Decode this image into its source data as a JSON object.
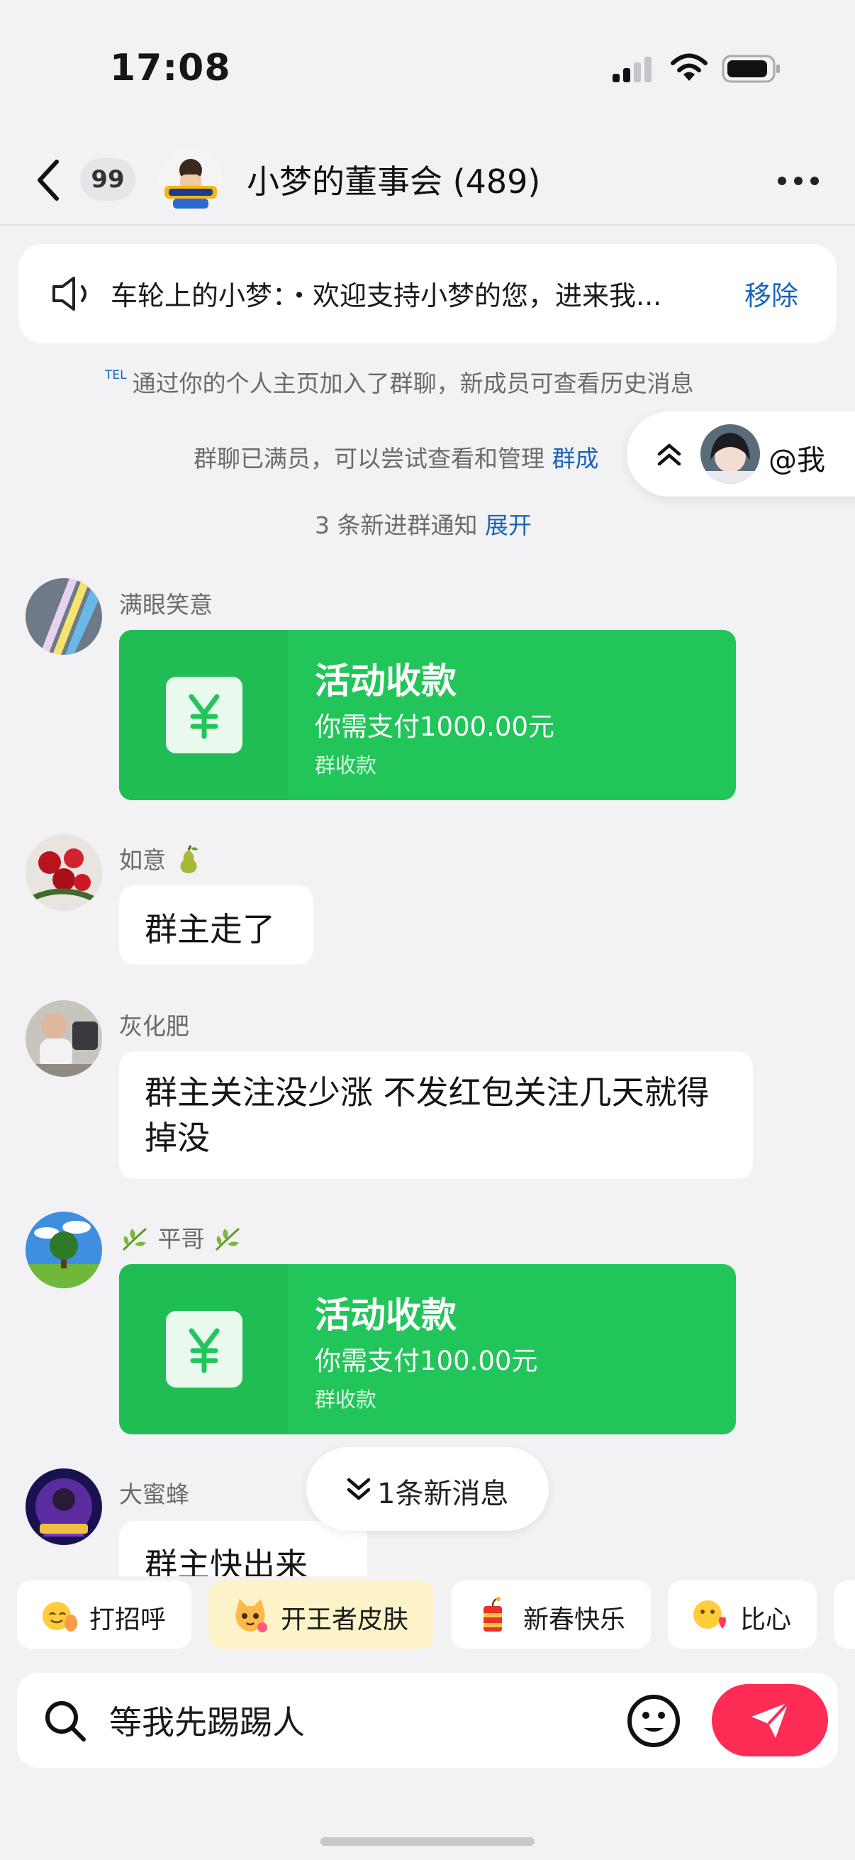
{
  "status_bar": {
    "time": "17:08"
  },
  "header": {
    "unread_count": "99",
    "title": "小梦的董事会 (489)"
  },
  "announcement": {
    "text": "车轮上的小梦：・欢迎支持小梦的您，进来我...",
    "remove_label": "移除"
  },
  "notices": {
    "tel_tag": "TEL",
    "join_text": "通过你的个人主页加入了群聊，新成员可查看历史消息",
    "full_text": "群聊已满员，可以尝试查看和管理 ",
    "full_link": "群成",
    "new_join_text": "3 条新进群通知 ",
    "expand_link": "展开"
  },
  "at_me": {
    "label": "@我"
  },
  "messages": [
    {
      "sender": "满眼笑意",
      "type": "payment",
      "title": "活动收款",
      "amount": "你需支付1000.00元",
      "pay_type": "群收款"
    },
    {
      "sender": "如意",
      "type": "text",
      "text": "群主走了"
    },
    {
      "sender": "灰化肥",
      "type": "text",
      "text": "群主关注没少涨 不发红包关注几天就得掉没"
    },
    {
      "sender": "平哥",
      "type": "payment",
      "title": "活动收款",
      "amount": "你需支付100.00元",
      "pay_type": "群收款"
    },
    {
      "sender": "大蜜蜂",
      "type": "text",
      "text": "群主快出来"
    }
  ],
  "new_message_pill": {
    "label": "1条新消息"
  },
  "quick_chips": [
    {
      "label": "打招呼",
      "icon": "wave-emoji-icon"
    },
    {
      "label": "开王者皮肤",
      "icon": "cat-emoji-icon"
    },
    {
      "label": "新春快乐",
      "icon": "firecracker-icon"
    },
    {
      "label": "比心",
      "icon": "heart-hand-emoji-icon"
    }
  ],
  "input": {
    "value": "等我先踢踢人"
  },
  "colors": {
    "accent_pink": "#fe2c55",
    "payment_green": "#22c55a",
    "link_blue": "#1a64b8"
  }
}
